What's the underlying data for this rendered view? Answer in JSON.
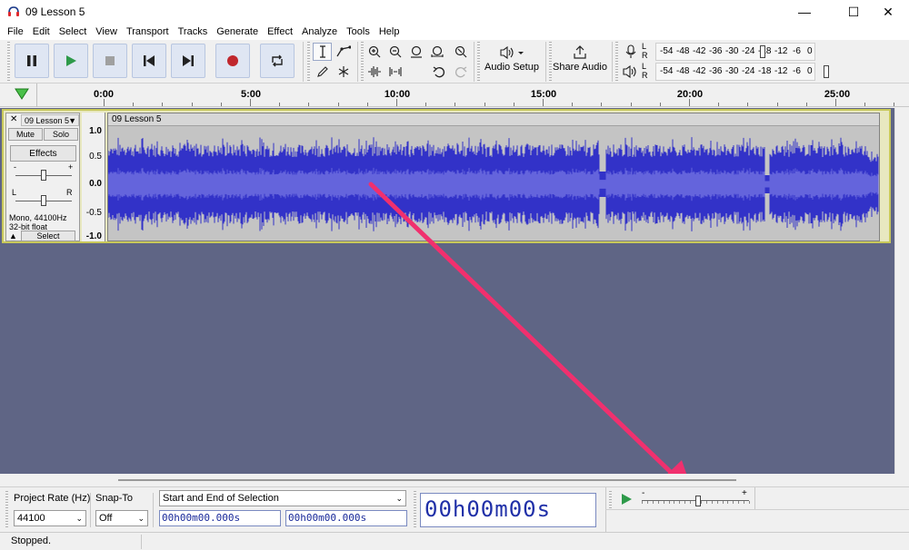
{
  "window": {
    "title": "09 Lesson 5",
    "minimize": "—",
    "maximize": "☐",
    "close": "✕"
  },
  "menu": [
    "File",
    "Edit",
    "Select",
    "View",
    "Transport",
    "Tracks",
    "Generate",
    "Effect",
    "Analyze",
    "Tools",
    "Help"
  ],
  "toolbar": {
    "audio_setup_label": "Audio Setup",
    "share_audio_label": "Share Audio",
    "meter_ticks": [
      "-54",
      "-48",
      "-42",
      "-36",
      "-30",
      "-24",
      "-18",
      "-12",
      "-6",
      "0"
    ],
    "record_channel_l": "L",
    "record_channel_r": "R",
    "play_channel_l": "L",
    "play_channel_r": "R"
  },
  "timeline": {
    "labels": [
      "0:00",
      "5:00",
      "10:00",
      "15:00",
      "20:00",
      "25:00"
    ]
  },
  "track": {
    "name": "09 Lesson 5",
    "mute_label": "Mute",
    "solo_label": "Solo",
    "effects_label": "Effects",
    "pan_left": "L",
    "pan_right": "R",
    "info_rate": "Mono, 44100Hz",
    "info_format": "32-bit float",
    "select_label": "Select",
    "clip_name": "09 Lesson 5",
    "ruler": [
      "1.0",
      "0.5",
      "0.0",
      "-0.5",
      "-1.0"
    ]
  },
  "selection_bar": {
    "project_rate_label": "Project Rate (Hz)",
    "project_rate_value": "44100",
    "snap_to_label": "Snap-To",
    "snap_to_value": "Off",
    "selection_mode": "Start and End of Selection",
    "start_time": "00h00m00.000s",
    "end_time": "00h00m00.000s",
    "audio_position": "00h00m00s",
    "speed_minus": "-",
    "speed_plus": "+"
  },
  "status": {
    "text": "Stopped."
  },
  "colors": {
    "waveform": "#3232c8",
    "waveform_light": "#6464dc",
    "arrow": "#f0306e",
    "track_bg": "#5f6585"
  }
}
